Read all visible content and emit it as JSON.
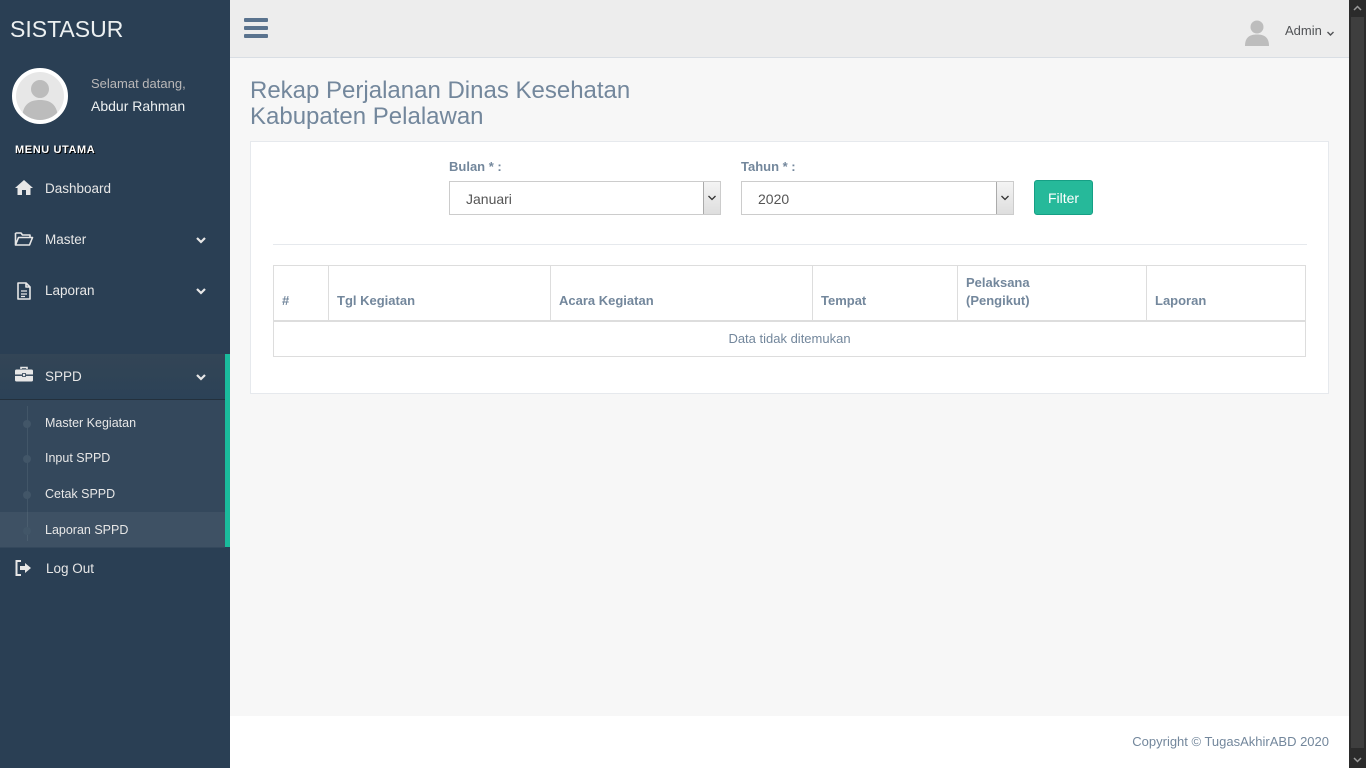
{
  "sidebar": {
    "brand": "SISTASUR",
    "welcome": "Selamat datang,",
    "username": "Abdur Rahman",
    "menu_title": "MENU UTAMA",
    "items": {
      "dashboard": "Dashboard",
      "master": "Master",
      "laporan": "Laporan",
      "sppd": "SPPD",
      "logout": "Log Out"
    },
    "sppd_sub": [
      "Master Kegiatan",
      "Input SPPD",
      "Cetak SPPD",
      "Laporan SPPD"
    ],
    "active_color": "#1ABB9C"
  },
  "topnav": {
    "user": "Admin"
  },
  "page": {
    "title_line1": "Rekap Perjalanan Dinas Kesehatan",
    "title_line2": "Kabupaten Pelalawan"
  },
  "filter": {
    "bulan_label": "Bulan * :",
    "bulan_value": "Januari",
    "tahun_label": "Tahun * :",
    "tahun_value": "2020",
    "button": "Filter",
    "button_color": "#26B99A"
  },
  "table": {
    "headers": [
      "#",
      "Tgl Kegiatan",
      "Acara Kegiatan",
      "Tempat",
      "Pelaksana",
      "(Pengikut)",
      "Laporan"
    ],
    "empty_message": "Data tidak ditemukan"
  },
  "footer": {
    "copyright": "Copyright © TugasAkhirABD 2020"
  }
}
